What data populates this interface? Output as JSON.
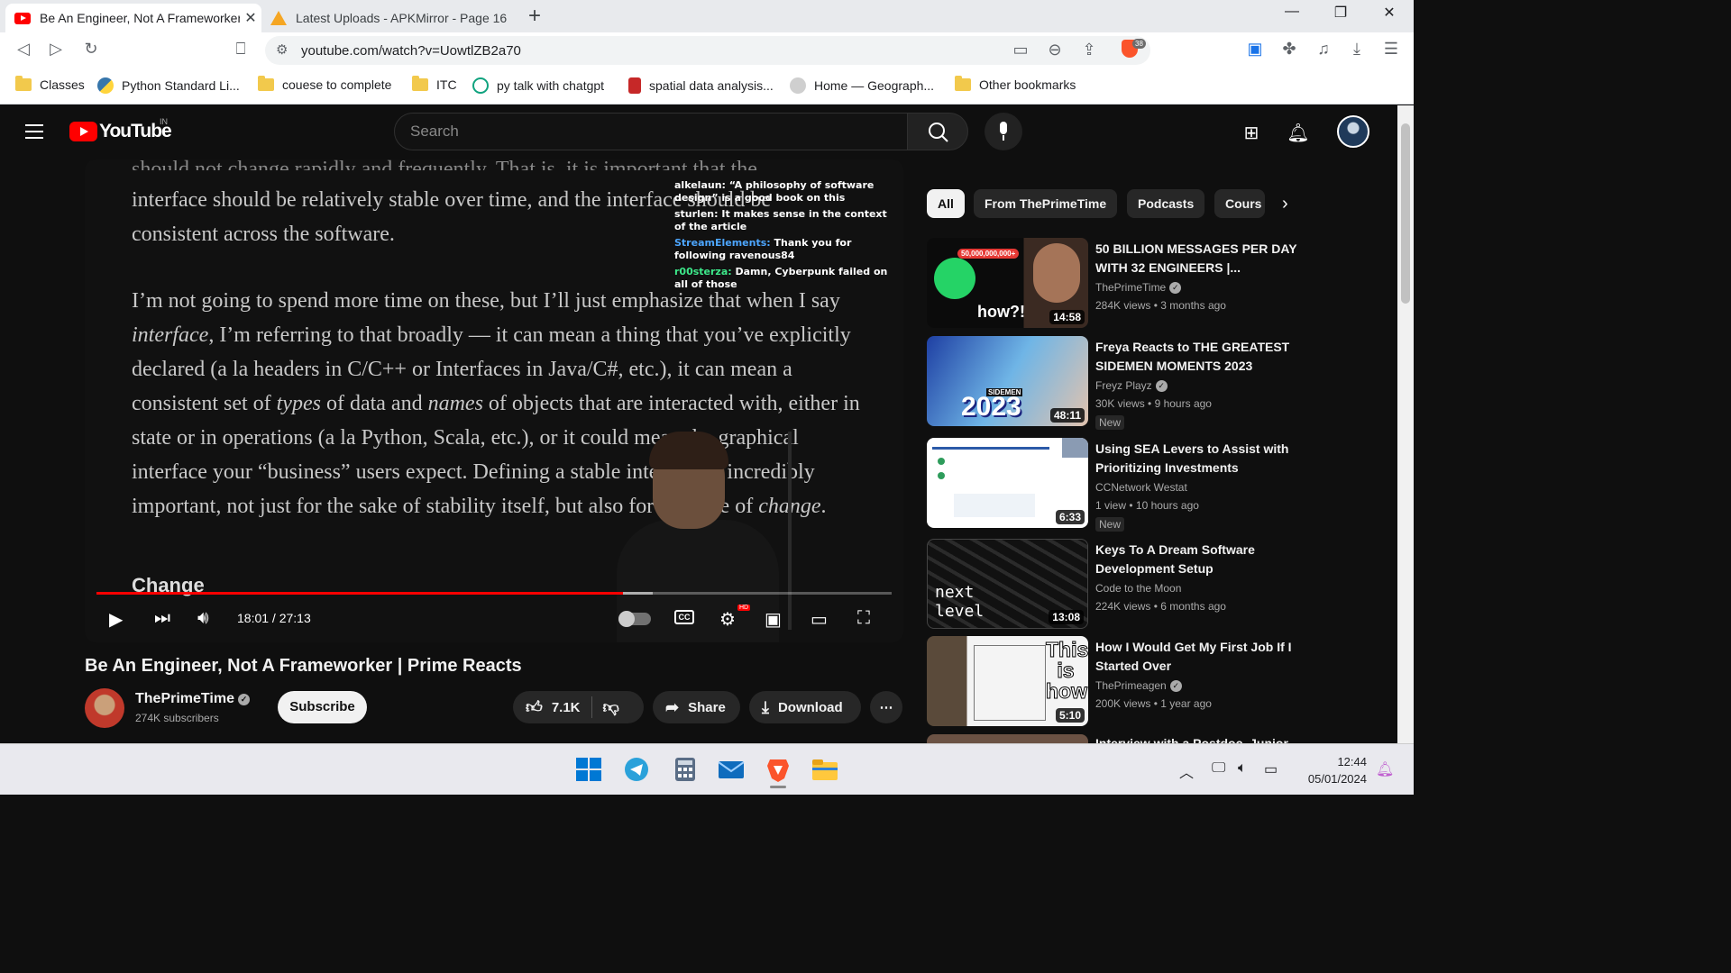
{
  "browser": {
    "tabs": [
      {
        "title": "Be An Engineer, Not A Frameworker | Prime Reacts",
        "active": true
      },
      {
        "title": "Latest Uploads - APKMirror - Page 16",
        "active": false
      }
    ],
    "url": "youtube.com/watch?v=UowtlZB2a70",
    "brave_shield_count": "38",
    "bookmarks": [
      {
        "label": "Classes",
        "icon": "folder-icon"
      },
      {
        "label": "Python Standard Li...",
        "icon": "python-icon"
      },
      {
        "label": "couese to complete",
        "icon": "folder-icon"
      },
      {
        "label": "ITC",
        "icon": "folder-icon"
      },
      {
        "label": "py talk with chatgpt",
        "icon": "chatgpt-icon"
      },
      {
        "label": "spatial data analysis...",
        "icon": "spatial-icon"
      },
      {
        "label": "Home — Geograph...",
        "icon": "geograph-icon"
      },
      {
        "label": "Other bookmarks",
        "icon": "folder-icon"
      }
    ]
  },
  "youtube": {
    "logo_text": "YouTube",
    "country_code": "IN",
    "search_placeholder": "Search",
    "video": {
      "article_paragraphs": [
        "should not change rapidly and frequently. That is, it is important that the interface should be relatively stable over time, and the interface should be consistent across the software.",
        ""
      ],
      "article_p1_line1": "interface should be relatively stable over time, and the interface should be",
      "article_p1_line2": "consistent across the software.",
      "article_p2": [
        {
          "t": "I’m not going to spend more time on these, but I’ll just emphasize that when I say "
        },
        {
          "i": "interface"
        },
        {
          "t": ", I’m referring to that broadly — it can mean a thing that you’ve explicitly declared (a la headers in C/C++ or Interfaces in Java/C#, etc.), it can mean a consistent set of "
        },
        {
          "i": "types"
        },
        {
          "t": " of data and "
        },
        {
          "i": "names"
        },
        {
          "t": " of objects that are interacted with, either in state or in operations (a la Python, Scala, etc.), or it could mean the graphical interface your “business” users expect. Defining a stable interface is incredibly important, not just for the sake of stability itself, but also for the sake of "
        },
        {
          "i": "change"
        },
        {
          "t": "."
        }
      ],
      "section_heading": "Change",
      "chat": [
        {
          "user": "alkelaun:",
          "msg": "“A philosophy of software design” is a good book on this"
        },
        {
          "user": "sturlen:",
          "msg": "It makes sense in the context of the article"
        },
        {
          "user": "StreamElements:",
          "msg": "Thank you for following ravenous84"
        },
        {
          "user": "r00sterza:",
          "msg": "Damn, Cyberpunk failed on all of those"
        }
      ],
      "time_current": "18:01",
      "time_total": "27:13",
      "time_display": "18:01 / 27:13",
      "progress_fraction": 0.662,
      "buffered_fraction": 0.7,
      "cc_label": "CC",
      "hd_label": "HD"
    },
    "title": "Be An Engineer, Not A Frameworker | Prime Reacts",
    "channel": {
      "name": "ThePrimeTime",
      "subscribers": "274K subscribers"
    },
    "subscribe_label": "Subscribe",
    "likes": "7.1K",
    "share_label": "Share",
    "download_label": "Download",
    "chips": [
      "All",
      "From ThePrimeTime",
      "Podcasts",
      "Cours"
    ],
    "recommendations": [
      {
        "title": "50 BILLION MESSAGES PER DAY WITH 32 ENGINEERS |...",
        "channel": "ThePrimeTime",
        "verified": true,
        "views": "284K views",
        "age": "3 months ago",
        "duration": "14:58",
        "new": "",
        "thumb_text": "how?!",
        "thumb_badge": "50,000,000,000+"
      },
      {
        "title": "Freya Reacts to THE GREATEST SIDEMEN MOMENTS 2023",
        "channel": "Freyz Playz",
        "verified": true,
        "views": "30K views",
        "age": "9 hours ago",
        "duration": "48:11",
        "new": "New",
        "thumb_text": "2023",
        "thumb_badge": "SIDEMEN"
      },
      {
        "title": "Using SEA Levers to Assist with Prioritizing Investments",
        "channel": "CCNetwork Westat",
        "verified": false,
        "views": "1 view",
        "age": "10 hours ago",
        "duration": "6:33",
        "new": "New",
        "thumb_text": "",
        "thumb_badge": ""
      },
      {
        "title": "Keys To A Dream Software Development Setup",
        "channel": "Code to the Moon",
        "verified": false,
        "views": "224K views",
        "age": "6 months ago",
        "duration": "13:08",
        "new": "",
        "thumb_text": "next level",
        "thumb_badge": ""
      },
      {
        "title": "How I Would Get My First Job If I Started Over",
        "channel": "ThePrimeagen",
        "verified": true,
        "views": "200K views",
        "age": "1 year ago",
        "duration": "5:10",
        "new": "",
        "thumb_text": "This is how",
        "thumb_badge": ""
      }
    ],
    "partial_rec_title": "Interview with a Postdoc, Junior"
  },
  "taskbar": {
    "time": "12:44",
    "date": "05/01/2024"
  },
  "colors": {
    "accent_red": "#ff0000",
    "yt_bg": "#0f0f0f",
    "chip_bg": "#272727"
  }
}
